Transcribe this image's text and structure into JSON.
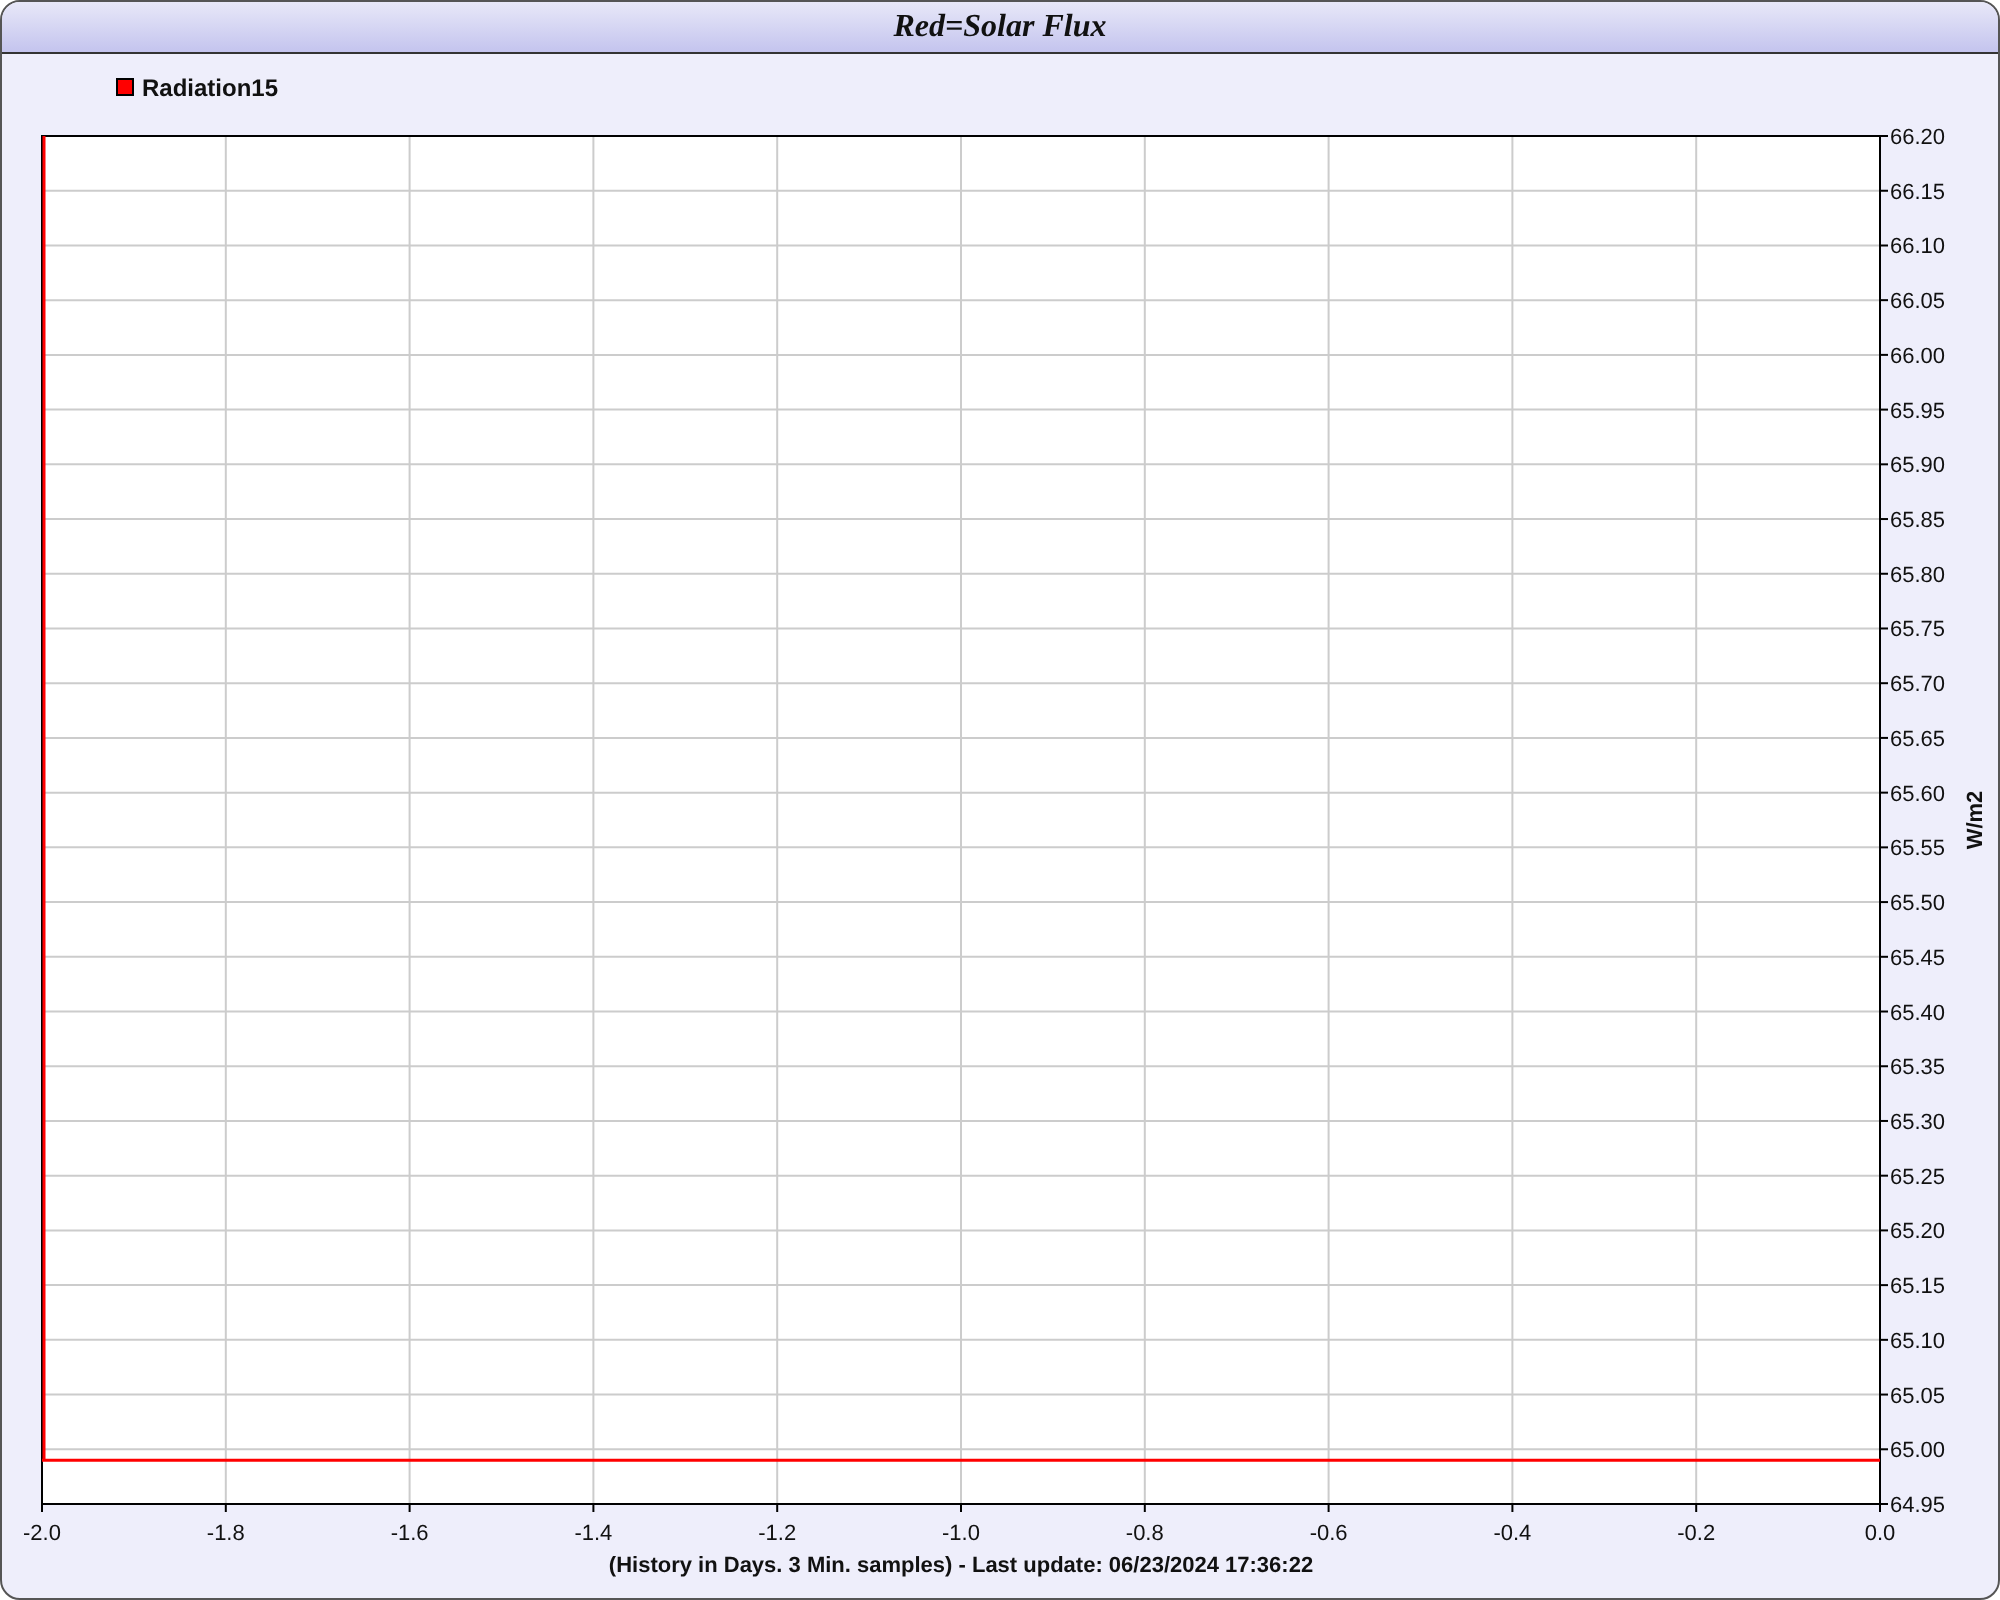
{
  "window": {
    "title": "Red=Solar Flux"
  },
  "chart": {
    "chart_data": {
      "type": "line",
      "xlabel": "(History in Days. 3 Min. samples) - Last update: 06/23/2024 17:36:22",
      "ylabel": "W/m2",
      "x": [
        -2.0,
        0.0
      ],
      "series": [
        {
          "name": "Radiation15",
          "color": "#ff0000",
          "values": [
            64.99,
            64.99
          ]
        }
      ],
      "grid": true,
      "xlim": [
        -2.0,
        0.0
      ],
      "ylim": [
        64.95,
        66.2
      ],
      "xticks": [
        {
          "value": -2.0,
          "label": "-2.0"
        },
        {
          "value": -1.8,
          "label": "-1.8"
        },
        {
          "value": -1.6,
          "label": "-1.6"
        },
        {
          "value": -1.4,
          "label": "-1.4"
        },
        {
          "value": -1.2,
          "label": "-1.2"
        },
        {
          "value": -1.0,
          "label": "-1.0"
        },
        {
          "value": -0.8,
          "label": "-0.8"
        },
        {
          "value": -0.6,
          "label": "-0.6"
        },
        {
          "value": -0.4,
          "label": "-0.4"
        },
        {
          "value": -0.2,
          "label": "-0.2"
        },
        {
          "value": 0.0,
          "label": "0.0"
        }
      ],
      "yticks": [
        {
          "value": 64.95,
          "label": "64.95"
        },
        {
          "value": 65.0,
          "label": "65.00"
        },
        {
          "value": 65.05,
          "label": "65.05"
        },
        {
          "value": 65.1,
          "label": "65.10"
        },
        {
          "value": 65.15,
          "label": "65.15"
        },
        {
          "value": 65.2,
          "label": "65.20"
        },
        {
          "value": 65.25,
          "label": "65.25"
        },
        {
          "value": 65.3,
          "label": "65.30"
        },
        {
          "value": 65.35,
          "label": "65.35"
        },
        {
          "value": 65.4,
          "label": "65.40"
        },
        {
          "value": 65.45,
          "label": "65.45"
        },
        {
          "value": 65.5,
          "label": "65.50"
        },
        {
          "value": 65.55,
          "label": "65.55"
        },
        {
          "value": 65.6,
          "label": "65.60"
        },
        {
          "value": 65.65,
          "label": "65.65"
        },
        {
          "value": 65.7,
          "label": "65.70"
        },
        {
          "value": 65.75,
          "label": "65.75"
        },
        {
          "value": 65.8,
          "label": "65.80"
        },
        {
          "value": 65.85,
          "label": "65.85"
        },
        {
          "value": 65.9,
          "label": "65.90"
        },
        {
          "value": 65.95,
          "label": "65.95"
        },
        {
          "value": 66.0,
          "label": "66.00"
        },
        {
          "value": 66.05,
          "label": "66.05"
        },
        {
          "value": 66.1,
          "label": "66.10"
        },
        {
          "value": 66.15,
          "label": "66.15"
        },
        {
          "value": 66.2,
          "label": "66.20"
        }
      ]
    }
  }
}
